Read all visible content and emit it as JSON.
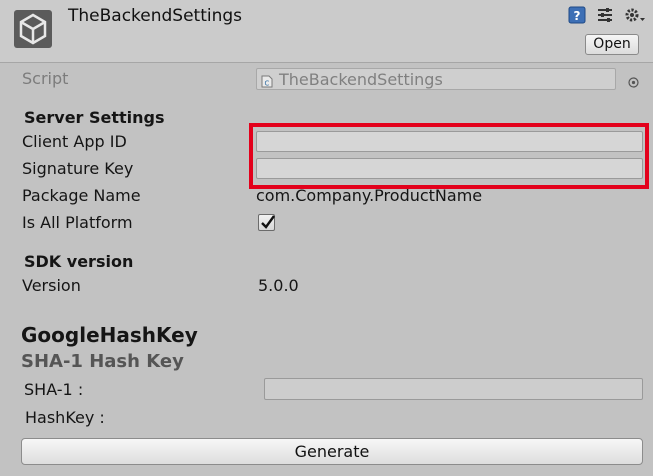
{
  "header": {
    "title": "TheBackendSettings",
    "open_label": "Open",
    "icons": [
      "unity-logo-icon",
      "help-icon",
      "presets-icon",
      "settings-gear-icon"
    ]
  },
  "script_row": {
    "label": "Script",
    "value": "TheBackendSettings",
    "icon": "csharp-script-icon"
  },
  "server_settings": {
    "heading": "Server Settings",
    "client_app_id_label": "Client App ID",
    "client_app_id_value": "",
    "signature_key_label": "Signature Key",
    "signature_key_value": "",
    "package_name_label": "Package Name",
    "package_name_value": "com.Company.ProductName",
    "is_all_platform_label": "Is All Platform",
    "is_all_platform_checked": true
  },
  "sdk": {
    "heading": "SDK version",
    "version_label": "Version",
    "version_value": "5.0.0"
  },
  "google_hash_key": {
    "heading": "GoogleHashKey",
    "subheading": "SHA-1 Hash Key",
    "sha1_label": "SHA-1 :",
    "sha1_value": "",
    "hashkey_label": "HashKey :",
    "generate_label": "Generate"
  },
  "colors": {
    "background": "#c2c2c2",
    "highlight": "#e3001b"
  }
}
